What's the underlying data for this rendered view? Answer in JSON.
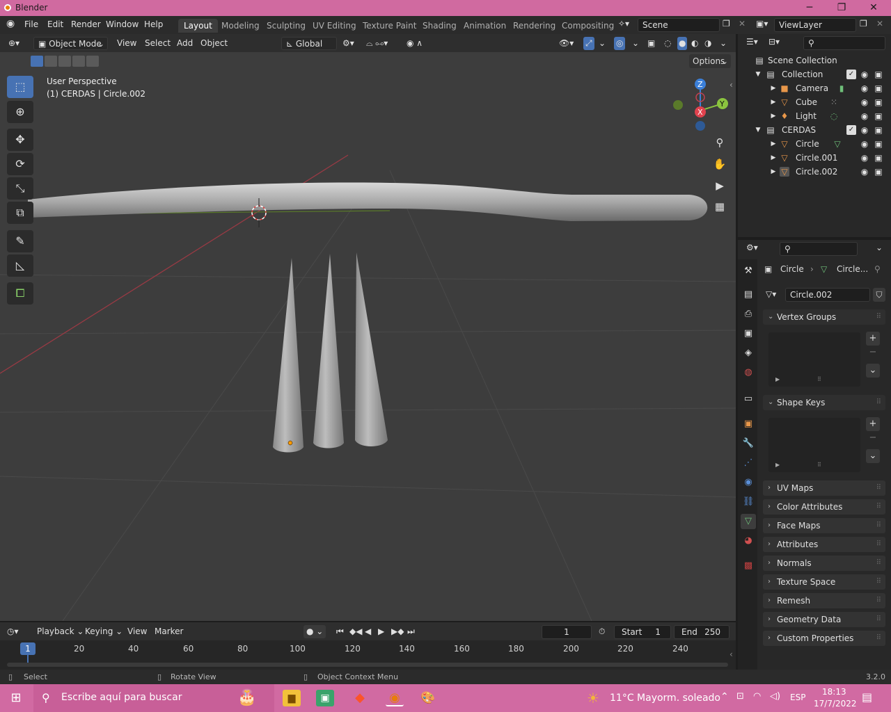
{
  "window": {
    "title": "Blender",
    "min_glyph": "─",
    "max_glyph": "❐",
    "close_glyph": "✕"
  },
  "menubar": {
    "items": [
      "File",
      "Edit",
      "Render",
      "Window",
      "Help"
    ],
    "workspaces": [
      "Layout",
      "Modeling",
      "Sculpting",
      "UV Editing",
      "Texture Paint",
      "Shading",
      "Animation",
      "Rendering",
      "Compositing"
    ],
    "active_workspace": "Layout",
    "scene": "Scene",
    "view_layer": "ViewLayer"
  },
  "viewport_header": {
    "mode": "Object Mode",
    "menus": [
      "View",
      "Select",
      "Add",
      "Object"
    ],
    "orientation": "Global",
    "options": "Options"
  },
  "viewport": {
    "perspective_label": "User Perspective",
    "object_label": "(1) CERDAS | Circle.002",
    "gizmo": {
      "z": "Z",
      "y": "Y",
      "x": "X"
    }
  },
  "timeline": {
    "menus": [
      "Playback",
      "Keying",
      "View",
      "Marker"
    ],
    "current_frame": "1",
    "start_label": "Start",
    "start_value": "1",
    "end_label": "End",
    "end_value": "250",
    "playhead": "1",
    "ticks": [
      "20",
      "40",
      "60",
      "80",
      "100",
      "120",
      "140",
      "160",
      "180",
      "200",
      "220",
      "240"
    ]
  },
  "statusbar": {
    "select": "Select",
    "rotate": "Rotate View",
    "context": "Object Context Menu",
    "version": "3.2.0"
  },
  "outliner": {
    "root": "Scene Collection",
    "rows": [
      {
        "label": "Collection",
        "indent": 1,
        "icon": "collection-icon"
      },
      {
        "label": "Camera",
        "indent": 2,
        "icon": "camera-icon"
      },
      {
        "label": "Cube",
        "indent": 2,
        "icon": "mesh-icon"
      },
      {
        "label": "Light",
        "indent": 2,
        "icon": "light-icon"
      },
      {
        "label": "CERDAS",
        "indent": 1,
        "icon": "collection-icon"
      },
      {
        "label": "Circle",
        "indent": 2,
        "icon": "mesh-icon"
      },
      {
        "label": "Circle.001",
        "indent": 2,
        "icon": "mesh-icon"
      },
      {
        "label": "Circle.002",
        "indent": 2,
        "icon": "mesh-icon"
      }
    ]
  },
  "properties": {
    "breadcrumb_object": "Circle",
    "breadcrumb_data": "Circle...",
    "data_name": "Circle.002",
    "open_panels": [
      "Vertex Groups",
      "Shape Keys"
    ],
    "closed_panels": [
      "UV Maps",
      "Color Attributes",
      "Face Maps",
      "Attributes",
      "Normals",
      "Texture Space",
      "Remesh",
      "Geometry Data",
      "Custom Properties"
    ]
  },
  "taskbar": {
    "search_placeholder": "Escribe aquí para buscar",
    "weather": "11°C  Mayorm. soleado",
    "language": "ESP",
    "time": "18:13",
    "date": "17/7/2022"
  },
  "colors": {
    "accent": "#4772b3",
    "titlebar": "#d06aa0",
    "x_axis": "#e0424e",
    "y_axis": "#8bc43f",
    "z_axis": "#3b7fd8"
  }
}
